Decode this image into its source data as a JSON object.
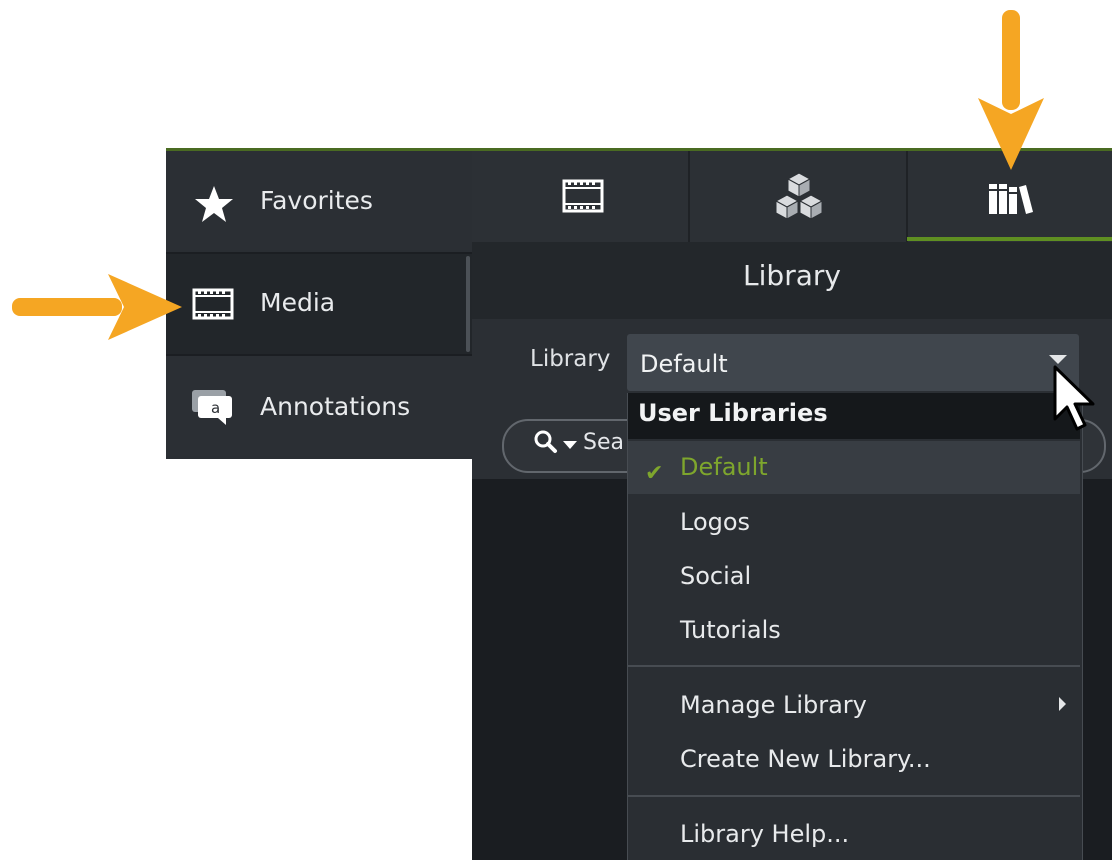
{
  "sidebar": {
    "items": [
      {
        "label": "Favorites",
        "icon": "star-icon"
      },
      {
        "label": "Media",
        "icon": "film-icon"
      },
      {
        "label": "Annotations",
        "icon": "callout-icon"
      }
    ]
  },
  "tabs": [
    {
      "icon": "film-icon"
    },
    {
      "icon": "cubes-icon"
    },
    {
      "icon": "library-books-icon"
    }
  ],
  "panel": {
    "title": "Library"
  },
  "library_select": {
    "label": "Library",
    "value": "Default"
  },
  "search": {
    "placeholder_visible": "Sea"
  },
  "menu": {
    "header": "User Libraries",
    "libraries": [
      "Default",
      "Logos",
      "Social",
      "Tutorials"
    ],
    "selected": "Default",
    "actions": [
      "Manage Library",
      "Create New Library..."
    ],
    "help": "Library Help..."
  },
  "colors": {
    "accent_green": "#7ea62d",
    "annotation_arrow": "#f5a623"
  }
}
